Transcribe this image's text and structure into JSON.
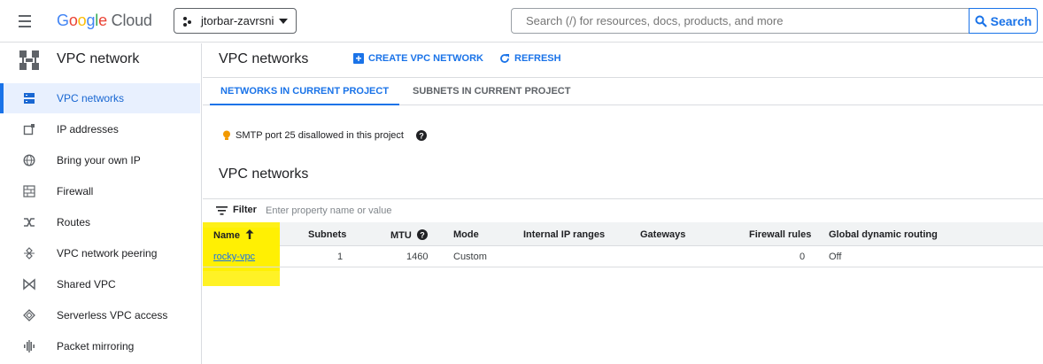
{
  "topbar": {
    "logo": {
      "g1": "G",
      "o1": "o",
      "o2": "o",
      "g2": "g",
      "l": "l",
      "e": "e",
      "cloud": " Cloud"
    },
    "project": "jtorbar-zavrsni",
    "search_placeholder": "Search (/) for resources, docs, products, and more",
    "search_button": "Search"
  },
  "sidebar": {
    "title": "VPC network",
    "items": [
      {
        "label": "VPC networks",
        "icon": "vpc-networks-icon",
        "active": true
      },
      {
        "label": "IP addresses",
        "icon": "ip-addresses-icon"
      },
      {
        "label": "Bring your own IP",
        "icon": "globe-icon"
      },
      {
        "label": "Firewall",
        "icon": "firewall-icon"
      },
      {
        "label": "Routes",
        "icon": "routes-icon"
      },
      {
        "label": "VPC network peering",
        "icon": "peering-icon"
      },
      {
        "label": "Shared VPC",
        "icon": "shared-vpc-icon"
      },
      {
        "label": "Serverless VPC access",
        "icon": "serverless-icon"
      },
      {
        "label": "Packet mirroring",
        "icon": "packet-mirroring-icon"
      }
    ]
  },
  "main": {
    "title": "VPC networks",
    "create_label": "CREATE VPC NETWORK",
    "refresh_label": "REFRESH",
    "tabs": [
      {
        "label": "NETWORKS IN CURRENT PROJECT",
        "active": true
      },
      {
        "label": "SUBNETS IN CURRENT PROJECT",
        "active": false
      }
    ],
    "notice": "SMTP port 25 disallowed in this project",
    "section_title": "VPC networks",
    "filter": {
      "label": "Filter",
      "placeholder": "Enter property name or value"
    },
    "table": {
      "columns": [
        "Name",
        "Subnets",
        "MTU",
        "Mode",
        "Internal IP ranges",
        "Gateways",
        "Firewall rules",
        "Global dynamic routing"
      ],
      "rows": [
        {
          "name": "rocky-vpc",
          "subnets": "1",
          "mtu": "1460",
          "mode": "Custom",
          "internal_ip_ranges": "",
          "gateways": "",
          "firewall_rules": "0",
          "global_dynamic_routing": "Off"
        }
      ]
    }
  },
  "colors": {
    "accent": "#1a73e8",
    "highlight": "#fff000",
    "active_bg": "#e8f0fe",
    "warning": "#f29900"
  }
}
